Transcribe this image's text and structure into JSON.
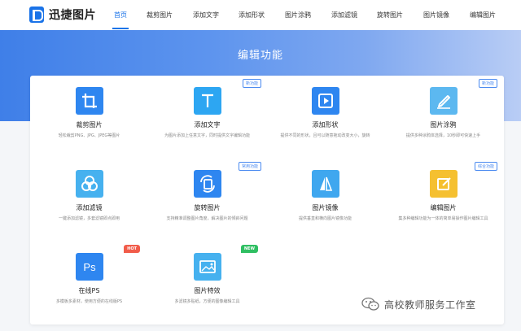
{
  "header": {
    "brand": "迅捷图片",
    "nav": [
      {
        "label": "首页",
        "active": true
      },
      {
        "label": "裁剪图片"
      },
      {
        "label": "添加文字"
      },
      {
        "label": "添加形状"
      },
      {
        "label": "图片涂鸦"
      },
      {
        "label": "添加滤镜"
      },
      {
        "label": "旋转图片"
      },
      {
        "label": "图片镜像"
      },
      {
        "label": "编辑图片"
      }
    ]
  },
  "banner": {
    "title": "编辑功能"
  },
  "tools": [
    {
      "title": "裁剪图片",
      "desc": "轻松裁剪PNG、JPG、JPEG等图片",
      "tag": "",
      "icon": "crop-icon",
      "color": "#2e86f0"
    },
    {
      "title": "添加文字",
      "desc": "为图片添加上任意文字，同时提供文字编辑功能",
      "tag": "新功能",
      "icon": "text-icon",
      "color": "#2da6f2"
    },
    {
      "title": "添加形状",
      "desc": "提供不同的形状，且可以随意拖动改变大小，旋转",
      "tag": "",
      "icon": "shape-icon",
      "color": "#2e86f0"
    },
    {
      "title": "图片涂鸦",
      "desc": "提供多种涂鸦体选择，10秒即可快速上手",
      "tag": "新功能",
      "icon": "brush-icon",
      "color": "#5cb8f0"
    },
    {
      "title": "添加滤镜",
      "desc": "一键添加滤镜，多套滤镜即点即用",
      "tag": "",
      "icon": "filter-icon",
      "color": "#46b1ef"
    },
    {
      "title": "旋转图片",
      "desc": "支持精准调整图片角度，解决图片的倾斜问题",
      "tag": "常用功能",
      "icon": "rotate-icon",
      "color": "#2e86f0"
    },
    {
      "title": "图片镜像",
      "desc": "提供垂直和横向图片镜像功能",
      "tag": "",
      "icon": "mirror-icon",
      "color": "#3fa7ef"
    },
    {
      "title": "编辑图片",
      "desc": "集多种编辑功能为一体的简单易操作图片编辑工具",
      "tag": "综合功能",
      "icon": "edit-icon",
      "color": "#f5c030"
    },
    {
      "title": "在线PS",
      "desc": "多模板多素材，使用方便的在线版PS",
      "tag": "HOT",
      "icon": "ps-icon",
      "color": "#2e86f0"
    },
    {
      "title": "图片特效",
      "desc": "多滤镜多贴纸，方便的图像编辑工具",
      "tag": "NEW",
      "icon": "effects-icon",
      "color": "#46b1ef"
    }
  ],
  "watermark": {
    "text": "高校教师服务工作室",
    "icon": "wechat-icon"
  }
}
